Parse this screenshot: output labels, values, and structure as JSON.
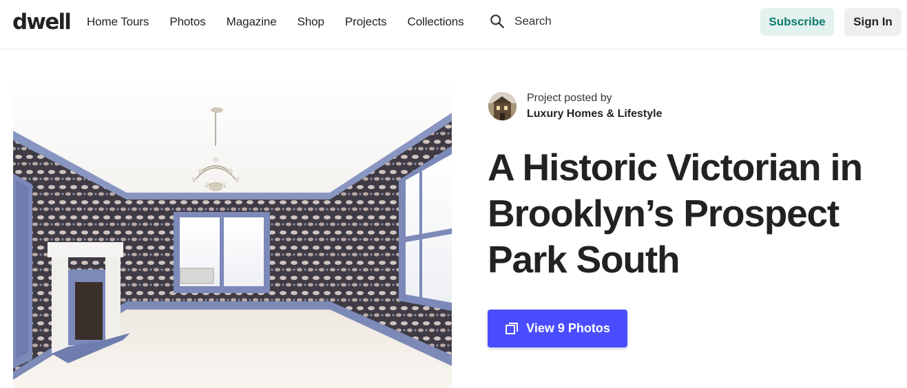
{
  "header": {
    "logo": "dwell",
    "nav": [
      {
        "label": "Home Tours"
      },
      {
        "label": "Photos"
      },
      {
        "label": "Magazine"
      },
      {
        "label": "Shop"
      },
      {
        "label": "Projects"
      },
      {
        "label": "Collections"
      }
    ],
    "search": {
      "icon": "search-icon",
      "label": "Search"
    },
    "subscribe_label": "Subscribe",
    "signin_label": "Sign In"
  },
  "hero": {
    "image_alt": "Empty Victorian room with patterned wallpaper, chandelier and fireplace"
  },
  "project": {
    "posted_by_label": "Project posted by",
    "author": "Luxury Homes & Lifestyle",
    "title": "A Historic Victorian in Brooklyn’s Prospect Park South",
    "view_photos_label": "View 9 Photos",
    "view_photos_icon": "gallery-icon"
  },
  "colors": {
    "accent_button": "#4a4dff",
    "subscribe_bg": "#e3f1ef",
    "subscribe_text": "#0e7c6b",
    "signin_bg": "#efefef",
    "text": "#222222"
  }
}
